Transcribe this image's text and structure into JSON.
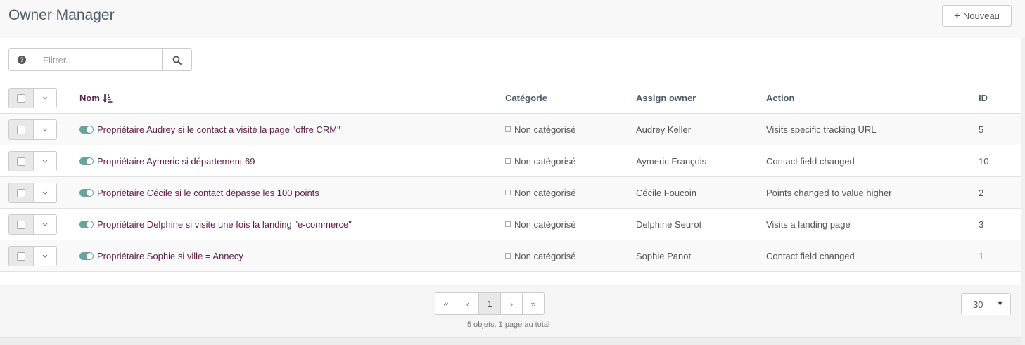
{
  "header": {
    "title": "Owner Manager",
    "new_button": "Nouveau"
  },
  "toolbar": {
    "filter_placeholder": "Filtrer...",
    "help_icon": "question-circle-icon",
    "search_icon": "search-icon"
  },
  "table": {
    "headers": {
      "name": "Nom",
      "category": "Catégorie",
      "owner": "Assign owner",
      "action": "Action",
      "id": "ID"
    },
    "rows": [
      {
        "name": "Propriétaire Audrey si le contact a visité la page \"offre CRM\"",
        "category": "Non catégorisé",
        "owner": "Audrey Keller",
        "action": "Visits specific tracking URL",
        "id": "5"
      },
      {
        "name": "Propriétaire Aymeric si département 69",
        "category": "Non catégorisé",
        "owner": "Aymeric François",
        "action": "Contact field changed",
        "id": "10"
      },
      {
        "name": "Propriétaire Cécile si le contact dépasse les 100 points",
        "category": "Non catégorisé",
        "owner": "Cécile Foucoin",
        "action": "Points changed to value higher",
        "id": "2"
      },
      {
        "name": "Propriétaire Delphine si visite une fois la landing \"e-commerce\"",
        "category": "Non catégorisé",
        "owner": "Delphine Seurot",
        "action": "Visits a landing page",
        "id": "3"
      },
      {
        "name": "Propriétaire Sophie si ville = Annecy",
        "category": "Non catégorisé",
        "owner": "Sophie Panot",
        "action": "Contact field changed",
        "id": "1"
      }
    ]
  },
  "pagination": {
    "first": "«",
    "prev": "‹",
    "current": "1",
    "next": "›",
    "last": "»",
    "summary": "5 objets, 1 page au total",
    "per_page": "30"
  },
  "colors": {
    "accent": "#5c1e47",
    "toggle_on": "#6aa1a3"
  }
}
